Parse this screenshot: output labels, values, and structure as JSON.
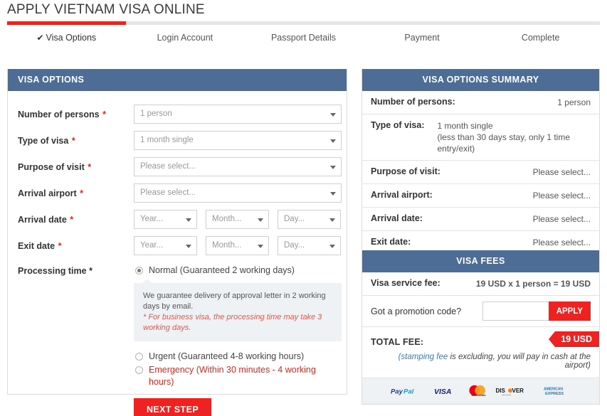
{
  "header": {
    "title": "APPLY VIETNAM VISA ONLINE",
    "progress_percent": 20,
    "steps": [
      {
        "label": "Visa Options",
        "active": true,
        "check": "✔"
      },
      {
        "label": "Login Account",
        "active": false
      },
      {
        "label": "Passport Details",
        "active": false
      },
      {
        "label": "Payment",
        "active": false
      },
      {
        "label": "Complete",
        "active": false
      }
    ]
  },
  "visa_options": {
    "panel_title": "VISA OPTIONS",
    "fields": [
      {
        "label": "Number of persons",
        "required": "*",
        "value": "1 person"
      },
      {
        "label": "Type of visa",
        "required": "*",
        "value": "1 month single"
      },
      {
        "label": "Purpose of visit",
        "required": "*",
        "value": "Please select..."
      },
      {
        "label": "Arrival airport",
        "required": "*",
        "value": "Please select..."
      }
    ],
    "arrival_date": {
      "label": "Arrival date",
      "required": "*",
      "year": "Year...",
      "month": "Month...",
      "day": "Day..."
    },
    "exit_date": {
      "label": "Exit date",
      "required": "*",
      "year": "Year...",
      "month": "Month...",
      "day": "Day..."
    },
    "processing_time": {
      "label": "Processing time",
      "required": "*",
      "options": [
        {
          "label": "Normal (Guaranteed 2 working days)",
          "selected": true,
          "danger": false
        },
        {
          "label": "Urgent (Guaranteed 4-8 working hours)",
          "selected": false,
          "danger": false
        },
        {
          "label": "Emergency (Within 30 minutes - 4 working hours)",
          "selected": false,
          "danger": true
        }
      ],
      "info_line1": "We guarantee delivery of approval letter in 2 working days by email.",
      "info_line2": "* For business visa, the processing time may take 3 working days."
    },
    "next_button": "NEXT STEP"
  },
  "summary": {
    "panel_title": "VISA OPTIONS SUMMARY",
    "rows": [
      {
        "key": "Number of persons:",
        "value": "1 person",
        "sub": ""
      },
      {
        "key": "Type of visa:",
        "value": "1 month single",
        "sub": "(less than 30 days stay, only 1 time entry/exit)"
      },
      {
        "key": "Purpose of visit:",
        "value": "Please select...",
        "sub": ""
      },
      {
        "key": "Arrival airport:",
        "value": "Please select...",
        "sub": ""
      },
      {
        "key": "Arrival date:",
        "value": "Please select...",
        "sub": ""
      },
      {
        "key": "Exit date:",
        "value": "Please select...",
        "sub": ""
      }
    ]
  },
  "fees": {
    "panel_title": "VISA FEES",
    "service_fee_label": "Visa service fee:",
    "service_fee_value": "19 USD x 1 person = 19 USD",
    "promo_label": "Got a promotion code?",
    "promo_value": "",
    "promo_placeholder": "",
    "apply_button": "APPLY",
    "total_label": "TOTAL FEE:",
    "total_value": "19 USD",
    "note_link": "(stamping fee",
    "note_text": " is excluding, you will pay in cash at the airport)",
    "payment_logos": [
      "PayPal",
      "VISA",
      "MasterCard",
      "DISCOVER",
      "American Express"
    ]
  },
  "colors": {
    "panel_header_blue": "#4e6d96",
    "accent_red": "#ef2222",
    "progress_red": "#e8241c",
    "fee_blue": "#2e5d8e",
    "info_bg": "#eef2f5"
  }
}
